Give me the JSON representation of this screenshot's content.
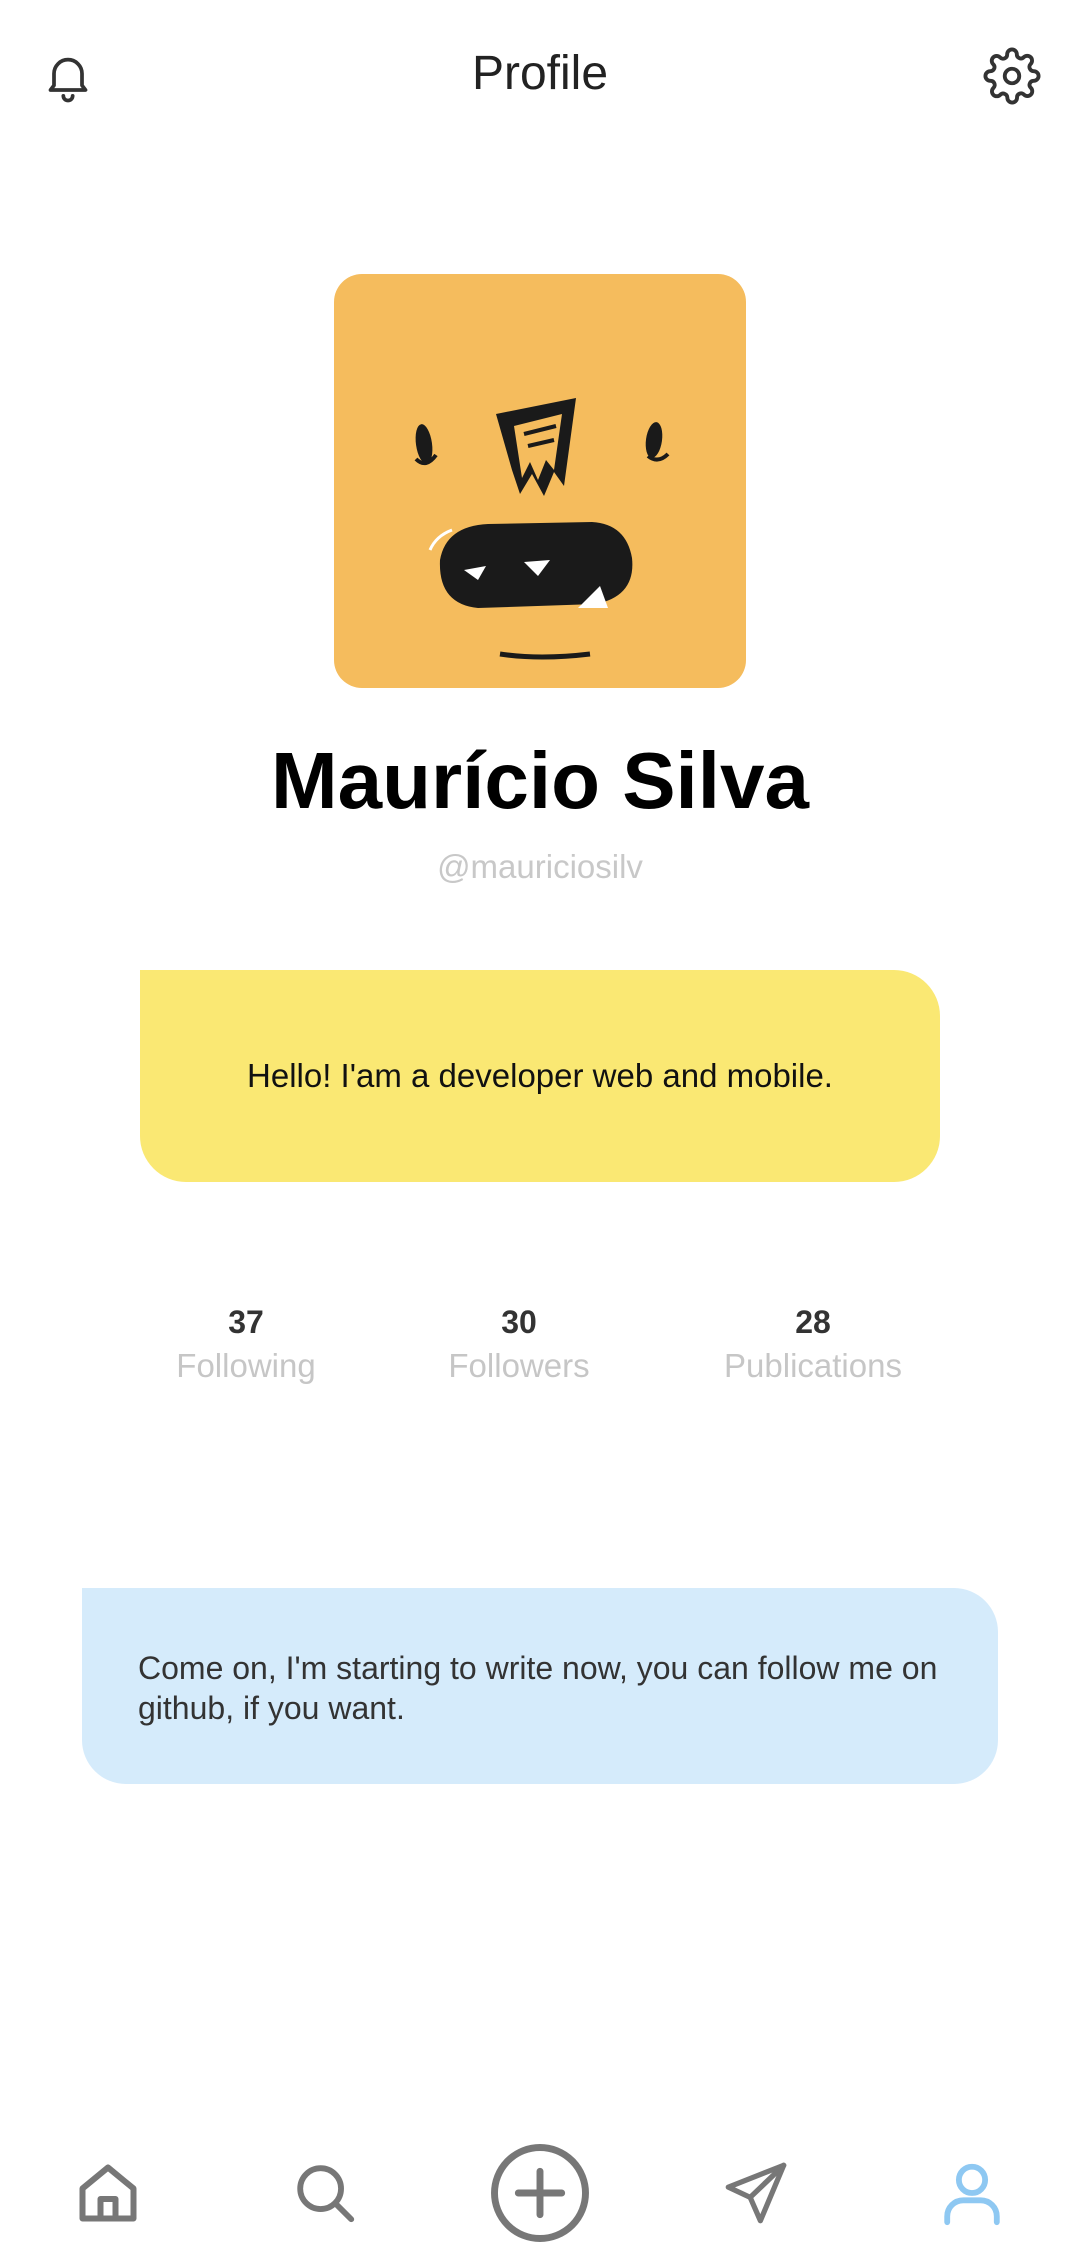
{
  "header": {
    "title": "Profile",
    "left_icon": "bell-icon",
    "right_icon": "gear-icon"
  },
  "profile": {
    "name": "Maurício Silva",
    "handle": "@mauriciosilv",
    "bio": "Hello! I'am a developer web and mobile."
  },
  "stats": [
    {
      "value": "37",
      "label": "Following"
    },
    {
      "value": "30",
      "label": "Followers"
    },
    {
      "value": "28",
      "label": "Publications"
    }
  ],
  "note": {
    "text": "Come on, I'm starting to write now, you can follow me on github, if you want."
  },
  "tabbar": {
    "items": [
      "home-icon",
      "search-icon",
      "add-icon",
      "send-icon",
      "user-icon"
    ],
    "active": "user-icon"
  },
  "colors": {
    "avatar_bg": "#f5bc5d",
    "bio_bg": "#fae873",
    "note_bg": "#d5ebfb",
    "active_tab": "#8ec8f2",
    "inactive_tab": "#777777"
  }
}
